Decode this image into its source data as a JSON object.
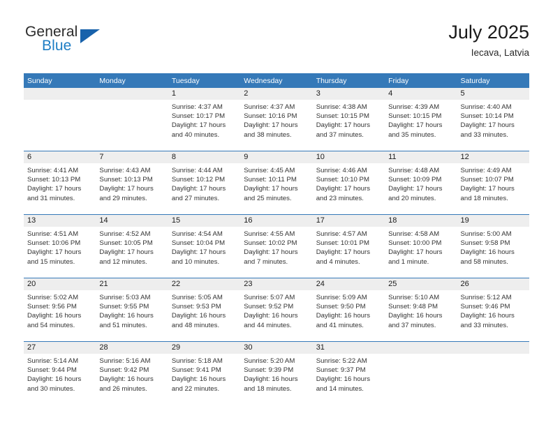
{
  "brand": {
    "name_part1": "General",
    "name_part2": "Blue",
    "triangle_icon": "triangle-icon",
    "accent_color": "#1862ab",
    "blue_text_color": "#1d7dc4"
  },
  "header": {
    "title": "July 2025",
    "location": "Iecava, Latvia"
  },
  "theme": {
    "header_bg": "#3579b8",
    "daynum_bg": "#eeeeee",
    "row_divider": "#3579b8"
  },
  "calendar": {
    "weekday_headers": [
      "Sunday",
      "Monday",
      "Tuesday",
      "Wednesday",
      "Thursday",
      "Friday",
      "Saturday"
    ],
    "labels": {
      "sunrise": "Sunrise:",
      "sunset": "Sunset:",
      "daylight": "Daylight:"
    },
    "weeks": [
      [
        {
          "day": "",
          "blank": true
        },
        {
          "day": "",
          "blank": true
        },
        {
          "day": "1",
          "sunrise": "Sunrise: 4:37 AM",
          "sunset": "Sunset: 10:17 PM",
          "daylight": "Daylight: 17 hours and 40 minutes."
        },
        {
          "day": "2",
          "sunrise": "Sunrise: 4:37 AM",
          "sunset": "Sunset: 10:16 PM",
          "daylight": "Daylight: 17 hours and 38 minutes."
        },
        {
          "day": "3",
          "sunrise": "Sunrise: 4:38 AM",
          "sunset": "Sunset: 10:15 PM",
          "daylight": "Daylight: 17 hours and 37 minutes."
        },
        {
          "day": "4",
          "sunrise": "Sunrise: 4:39 AM",
          "sunset": "Sunset: 10:15 PM",
          "daylight": "Daylight: 17 hours and 35 minutes."
        },
        {
          "day": "5",
          "sunrise": "Sunrise: 4:40 AM",
          "sunset": "Sunset: 10:14 PM",
          "daylight": "Daylight: 17 hours and 33 minutes."
        }
      ],
      [
        {
          "day": "6",
          "sunrise": "Sunrise: 4:41 AM",
          "sunset": "Sunset: 10:13 PM",
          "daylight": "Daylight: 17 hours and 31 minutes."
        },
        {
          "day": "7",
          "sunrise": "Sunrise: 4:43 AM",
          "sunset": "Sunset: 10:13 PM",
          "daylight": "Daylight: 17 hours and 29 minutes."
        },
        {
          "day": "8",
          "sunrise": "Sunrise: 4:44 AM",
          "sunset": "Sunset: 10:12 PM",
          "daylight": "Daylight: 17 hours and 27 minutes."
        },
        {
          "day": "9",
          "sunrise": "Sunrise: 4:45 AM",
          "sunset": "Sunset: 10:11 PM",
          "daylight": "Daylight: 17 hours and 25 minutes."
        },
        {
          "day": "10",
          "sunrise": "Sunrise: 4:46 AM",
          "sunset": "Sunset: 10:10 PM",
          "daylight": "Daylight: 17 hours and 23 minutes."
        },
        {
          "day": "11",
          "sunrise": "Sunrise: 4:48 AM",
          "sunset": "Sunset: 10:09 PM",
          "daylight": "Daylight: 17 hours and 20 minutes."
        },
        {
          "day": "12",
          "sunrise": "Sunrise: 4:49 AM",
          "sunset": "Sunset: 10:07 PM",
          "daylight": "Daylight: 17 hours and 18 minutes."
        }
      ],
      [
        {
          "day": "13",
          "sunrise": "Sunrise: 4:51 AM",
          "sunset": "Sunset: 10:06 PM",
          "daylight": "Daylight: 17 hours and 15 minutes."
        },
        {
          "day": "14",
          "sunrise": "Sunrise: 4:52 AM",
          "sunset": "Sunset: 10:05 PM",
          "daylight": "Daylight: 17 hours and 12 minutes."
        },
        {
          "day": "15",
          "sunrise": "Sunrise: 4:54 AM",
          "sunset": "Sunset: 10:04 PM",
          "daylight": "Daylight: 17 hours and 10 minutes."
        },
        {
          "day": "16",
          "sunrise": "Sunrise: 4:55 AM",
          "sunset": "Sunset: 10:02 PM",
          "daylight": "Daylight: 17 hours and 7 minutes."
        },
        {
          "day": "17",
          "sunrise": "Sunrise: 4:57 AM",
          "sunset": "Sunset: 10:01 PM",
          "daylight": "Daylight: 17 hours and 4 minutes."
        },
        {
          "day": "18",
          "sunrise": "Sunrise: 4:58 AM",
          "sunset": "Sunset: 10:00 PM",
          "daylight": "Daylight: 17 hours and 1 minute."
        },
        {
          "day": "19",
          "sunrise": "Sunrise: 5:00 AM",
          "sunset": "Sunset: 9:58 PM",
          "daylight": "Daylight: 16 hours and 58 minutes."
        }
      ],
      [
        {
          "day": "20",
          "sunrise": "Sunrise: 5:02 AM",
          "sunset": "Sunset: 9:56 PM",
          "daylight": "Daylight: 16 hours and 54 minutes."
        },
        {
          "day": "21",
          "sunrise": "Sunrise: 5:03 AM",
          "sunset": "Sunset: 9:55 PM",
          "daylight": "Daylight: 16 hours and 51 minutes."
        },
        {
          "day": "22",
          "sunrise": "Sunrise: 5:05 AM",
          "sunset": "Sunset: 9:53 PM",
          "daylight": "Daylight: 16 hours and 48 minutes."
        },
        {
          "day": "23",
          "sunrise": "Sunrise: 5:07 AM",
          "sunset": "Sunset: 9:52 PM",
          "daylight": "Daylight: 16 hours and 44 minutes."
        },
        {
          "day": "24",
          "sunrise": "Sunrise: 5:09 AM",
          "sunset": "Sunset: 9:50 PM",
          "daylight": "Daylight: 16 hours and 41 minutes."
        },
        {
          "day": "25",
          "sunrise": "Sunrise: 5:10 AM",
          "sunset": "Sunset: 9:48 PM",
          "daylight": "Daylight: 16 hours and 37 minutes."
        },
        {
          "day": "26",
          "sunrise": "Sunrise: 5:12 AM",
          "sunset": "Sunset: 9:46 PM",
          "daylight": "Daylight: 16 hours and 33 minutes."
        }
      ],
      [
        {
          "day": "27",
          "sunrise": "Sunrise: 5:14 AM",
          "sunset": "Sunset: 9:44 PM",
          "daylight": "Daylight: 16 hours and 30 minutes."
        },
        {
          "day": "28",
          "sunrise": "Sunrise: 5:16 AM",
          "sunset": "Sunset: 9:42 PM",
          "daylight": "Daylight: 16 hours and 26 minutes."
        },
        {
          "day": "29",
          "sunrise": "Sunrise: 5:18 AM",
          "sunset": "Sunset: 9:41 PM",
          "daylight": "Daylight: 16 hours and 22 minutes."
        },
        {
          "day": "30",
          "sunrise": "Sunrise: 5:20 AM",
          "sunset": "Sunset: 9:39 PM",
          "daylight": "Daylight: 16 hours and 18 minutes."
        },
        {
          "day": "31",
          "sunrise": "Sunrise: 5:22 AM",
          "sunset": "Sunset: 9:37 PM",
          "daylight": "Daylight: 16 hours and 14 minutes."
        },
        {
          "day": "",
          "blank": true
        },
        {
          "day": "",
          "blank": true
        }
      ]
    ]
  }
}
